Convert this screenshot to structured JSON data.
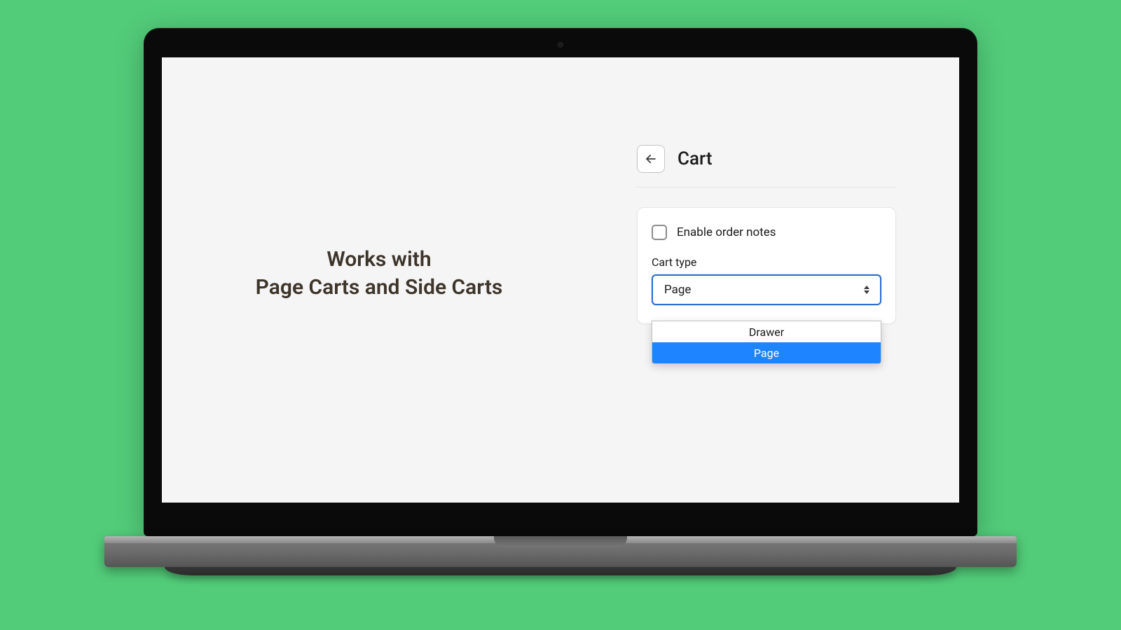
{
  "tagline": {
    "line1": "Works with",
    "line2": "Page Carts and Side Carts"
  },
  "panel": {
    "title": "Cart",
    "checkbox_label": "Enable order notes",
    "cart_type_label": "Cart type",
    "cart_type_value": "Page",
    "options": [
      "Drawer",
      "Page"
    ],
    "selected_option": "Page"
  }
}
